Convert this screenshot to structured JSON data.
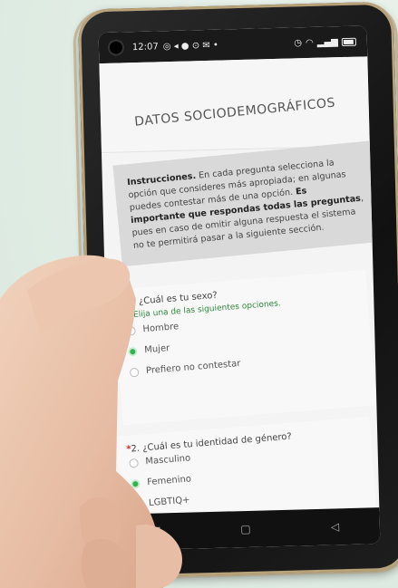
{
  "status_bar": {
    "time": "12:07"
  },
  "form": {
    "title": "DATOS SOCIODEMOGRÁFICOS",
    "instructions": {
      "lead": "Instrucciones.",
      "text1": " En cada pregunta selecciona la opción que consideres más apropiada; en algunas puedes contestar más de una opción. ",
      "emph1": "Es importante que respondas todas las preguntas",
      "text2": ", pues en caso de omitir alguna respuesta el sistema no te permitirá pasar a la siguiente sección."
    },
    "questions": [
      {
        "asterisk": "*",
        "label": "1. ¿Cuál es tu sexo?",
        "hint": "Elija una de las siguientes opciones.",
        "options": [
          "Hombre",
          "Mujer",
          "Prefiero no contestar"
        ],
        "selected": "Mujer"
      },
      {
        "asterisk": "*",
        "label": "2. ¿Cuál es tu identidad de género?",
        "options": [
          "Masculino",
          "Femenino",
          "LGBTIQ+"
        ],
        "selected": "Femenino"
      }
    ]
  },
  "nav": {
    "menu_icon": "menu-icon",
    "home_icon": "home-icon",
    "back_icon": "back-icon"
  }
}
